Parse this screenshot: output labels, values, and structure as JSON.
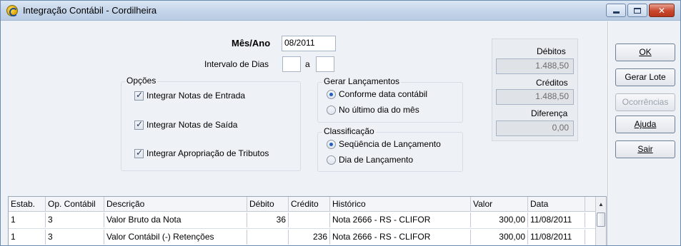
{
  "window": {
    "title": "Integração Contábil - Cordilheira"
  },
  "period": {
    "mes_ano_label": "Mês/Ano",
    "mes_ano_value": "08/2011",
    "intervalo_label": "Intervalo de Dias",
    "intervalo_from": "",
    "intervalo_sep": "a",
    "intervalo_to": ""
  },
  "opcoes": {
    "title": "Opções",
    "items": [
      {
        "label": "Integrar Notas de Entrada",
        "checked": true
      },
      {
        "label": "Integrar Notas de Saída",
        "checked": true
      },
      {
        "label": "Integrar Apropriação de Tributos",
        "checked": true
      }
    ]
  },
  "gerar": {
    "title": "Gerar Lançamentos",
    "options": [
      {
        "label": "Conforme data contábil",
        "selected": true
      },
      {
        "label": "No último dia do mês",
        "selected": false
      }
    ]
  },
  "classificacao": {
    "title": "Classificação",
    "options": [
      {
        "label": "Seqüência de Lançamento",
        "selected": true
      },
      {
        "label": "Dia de Lançamento",
        "selected": false
      }
    ]
  },
  "totals": {
    "debitos_label": "Débitos",
    "debitos_value": "1.488,50",
    "creditos_label": "Créditos",
    "creditos_value": "1.488,50",
    "diferenca_label": "Diferença",
    "diferenca_value": "0,00"
  },
  "buttons": {
    "ok": "OK",
    "gerar_lote": "Gerar Lote",
    "ocorrencias": "Ocorrências",
    "ajuda": "Ajuda",
    "sair": "Sair"
  },
  "table": {
    "columns": [
      "Estab.",
      "Op. Contábil",
      "Descrição",
      "Débito",
      "Crédito",
      "Histórico",
      "Valor",
      "Data"
    ],
    "rows": [
      [
        "1",
        "3",
        "Valor Bruto da Nota",
        "36",
        "",
        "Nota 2666 - RS - CLIFOR",
        "300,00",
        "11/08/2011"
      ],
      [
        "1",
        "3",
        "Valor Contábil (-) Retenções",
        "",
        "236",
        "Nota 2666 - RS - CLIFOR",
        "300,00",
        "11/08/2011"
      ]
    ]
  },
  "icons": {
    "app": "cordilheira-app-icon",
    "minimize": "minimize-icon",
    "maximize": "maximize-icon",
    "close": "close-icon",
    "scroll_up": "scroll-up-arrow-icon"
  },
  "colors": {
    "title_bar": "#c4d5ea",
    "close_button": "#c9472c",
    "window_bg": "#eef1f5"
  }
}
